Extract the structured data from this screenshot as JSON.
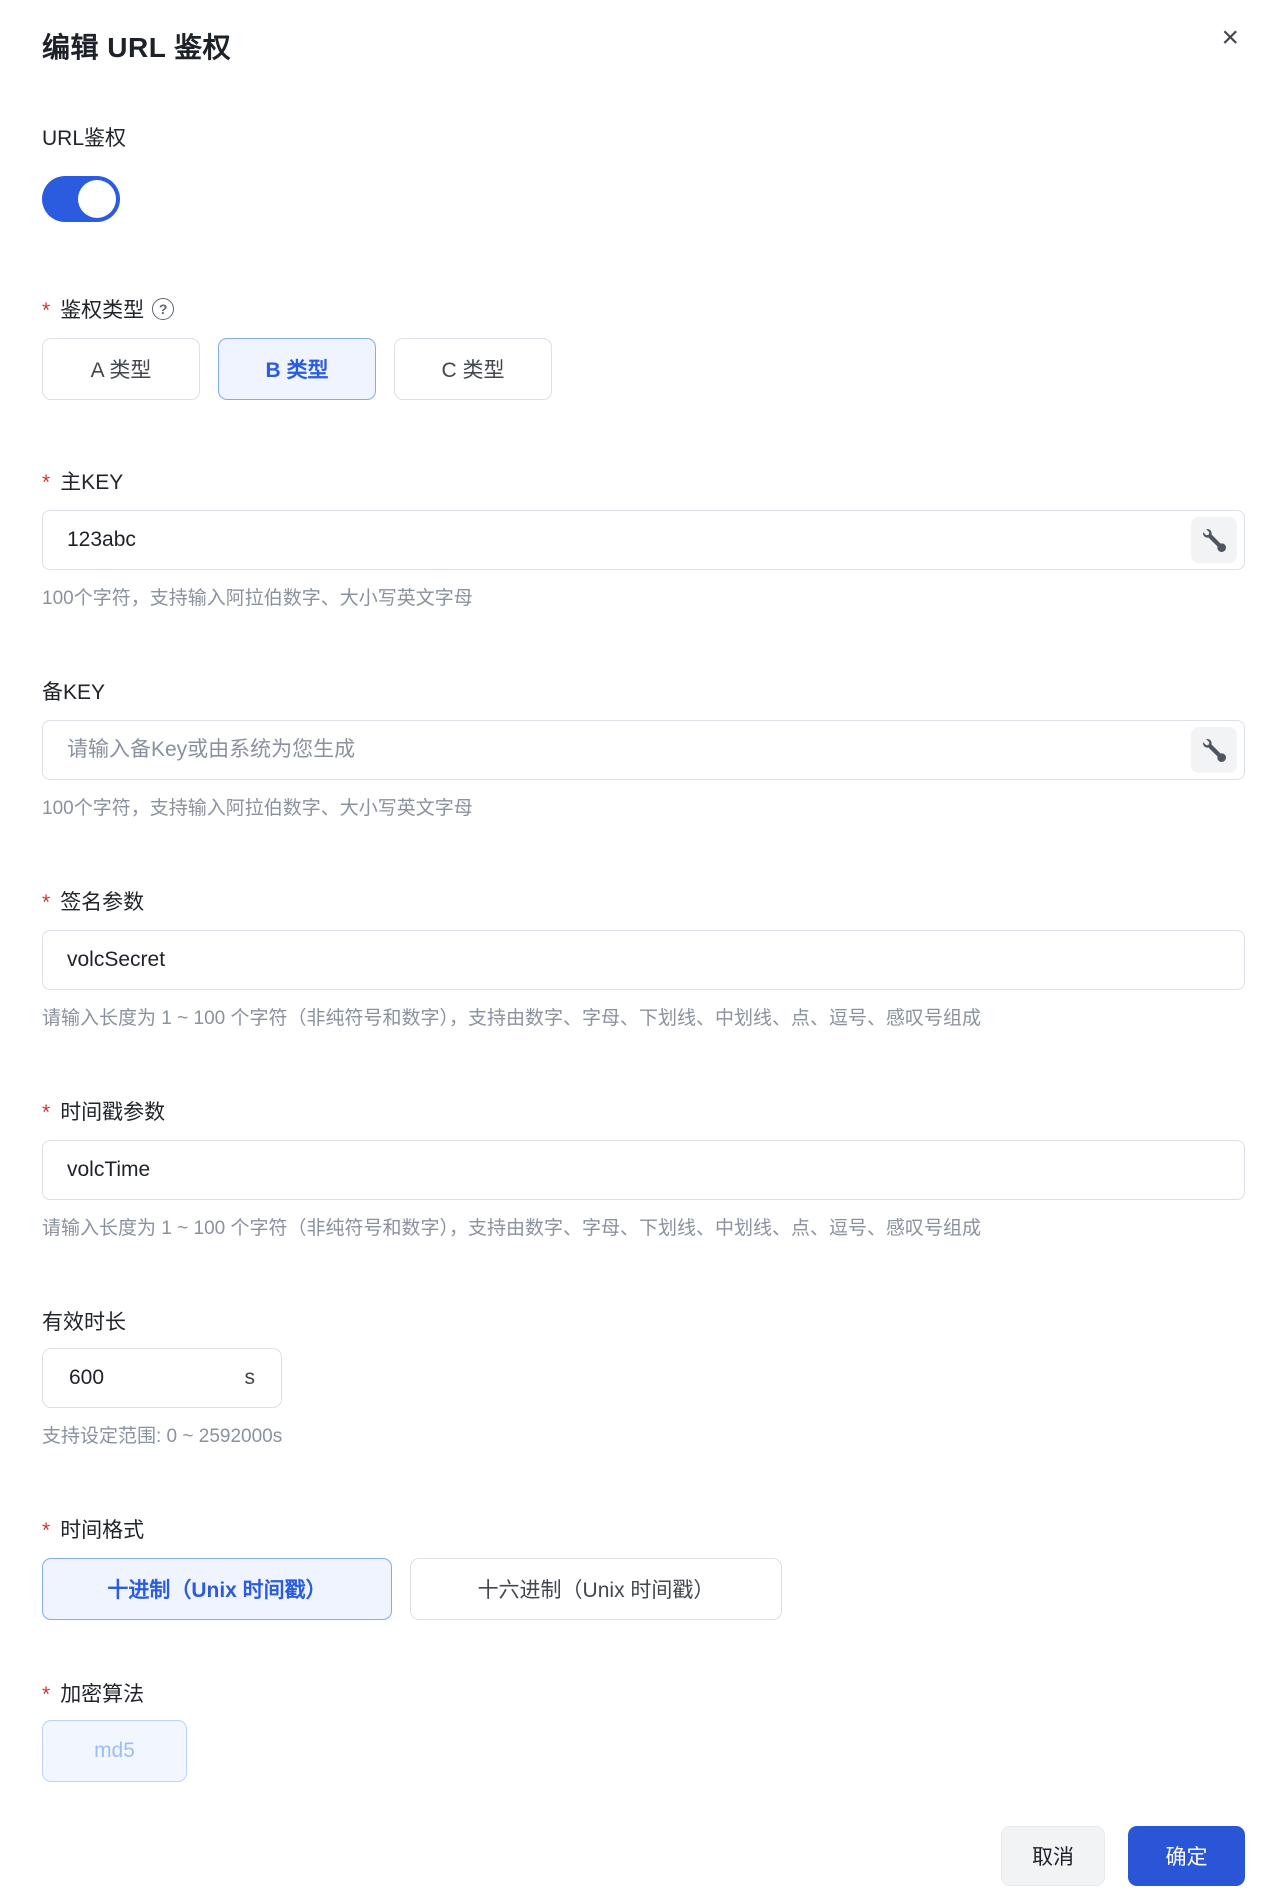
{
  "ui": {
    "required_marker": "*",
    "help_icon": "?"
  },
  "dialog": {
    "title": "编辑 URL 鉴权",
    "close_icon": "×"
  },
  "url_auth": {
    "label": "URL鉴权",
    "state": "on"
  },
  "auth_type": {
    "label": "鉴权类型",
    "required": true,
    "options": [
      {
        "label": "A 类型",
        "selected": false
      },
      {
        "label": "B 类型",
        "selected": true
      },
      {
        "label": "C 类型",
        "selected": false
      }
    ]
  },
  "primary_key": {
    "label": "主KEY",
    "required": true,
    "value": "123abc",
    "hint": "100个字符，支持输入阿拉伯数字、大小写英文字母"
  },
  "backup_key": {
    "label": "备KEY",
    "required": false,
    "placeholder": "请输入备Key或由系统为您生成",
    "hint": "100个字符，支持输入阿拉伯数字、大小写英文字母"
  },
  "sign_param": {
    "label": "签名参数",
    "required": true,
    "value": "volcSecret",
    "hint": "请输入长度为 1 ~ 100 个字符（非纯符号和数字），支持由数字、字母、下划线、中划线、点、逗号、感叹号组成"
  },
  "timestamp_param": {
    "label": "时间戳参数",
    "required": true,
    "value": "volcTime",
    "hint": "请输入长度为 1 ~ 100 个字符（非纯符号和数字），支持由数字、字母、下划线、中划线、点、逗号、感叹号组成"
  },
  "duration": {
    "label": "有效时长",
    "required": false,
    "value": "600",
    "unit": "s",
    "hint": "支持设定范围: 0 ~ 2592000s"
  },
  "time_format": {
    "label": "时间格式",
    "required": true,
    "options": [
      {
        "label": "十进制（Unix 时间戳）",
        "selected": true
      },
      {
        "label": "十六进制（Unix 时间戳）",
        "selected": false
      }
    ]
  },
  "algorithm": {
    "label": "加密算法",
    "required": true,
    "options": [
      {
        "label": "md5",
        "selected": true,
        "disabled": true
      }
    ]
  },
  "footer": {
    "cancel": "取消",
    "confirm": "确定"
  },
  "colors": {
    "primary": "#2b5ce0",
    "confirm_button": "#2a55d6",
    "selected_bg": "#f0f4fe",
    "selected_border": "#84a9f9",
    "disabled_chip_text": "#9cbcf9",
    "required_red": "#d7342c",
    "hint_gray": "#8a919f",
    "border_gray": "#dde0e6"
  }
}
